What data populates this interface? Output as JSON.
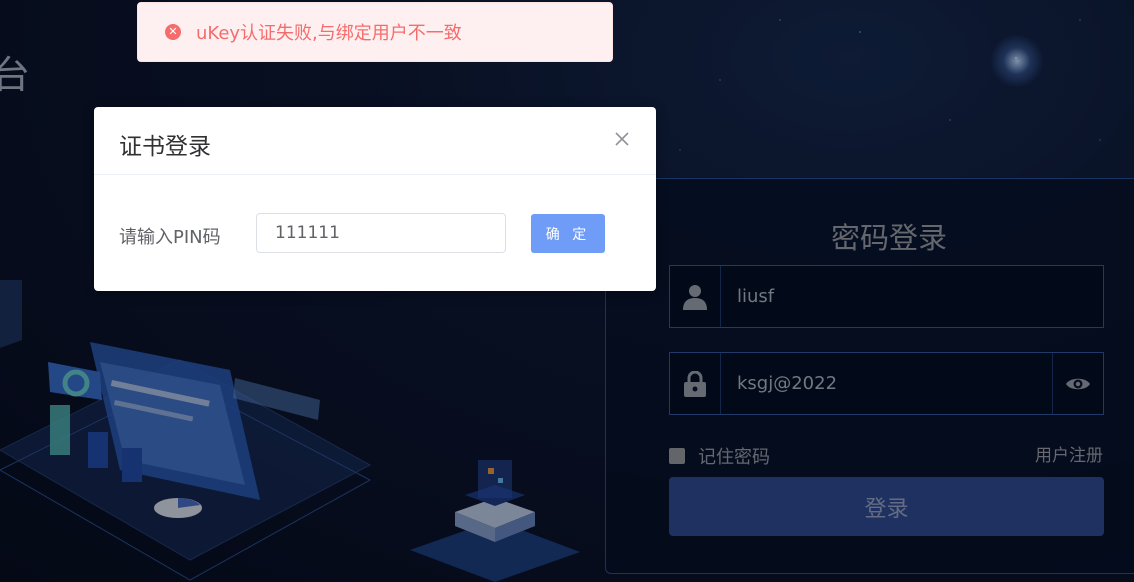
{
  "background": {
    "title_fragment": "台"
  },
  "toast": {
    "message": "uKey认证失败,与绑定用户不一致",
    "icon": "error-circle-icon",
    "color": "#f56c6c"
  },
  "dialog": {
    "title": "证书登录",
    "pin_label": "请输入PIN码",
    "pin_value": "111111",
    "confirm_label": "确 定",
    "close_icon": "close-icon"
  },
  "login": {
    "title": "密码登录",
    "username": "liusf",
    "password": "ksgj@2022",
    "remember_label": "记住密码",
    "register_label": "用户注册",
    "submit_label": "登录",
    "icons": {
      "user": "user-icon",
      "lock": "lock-icon",
      "eye": "eye-icon"
    }
  },
  "colors": {
    "primary_button": "#6e9cf6",
    "login_button": "#2b4585",
    "panel_border": "#1f4a8a"
  }
}
